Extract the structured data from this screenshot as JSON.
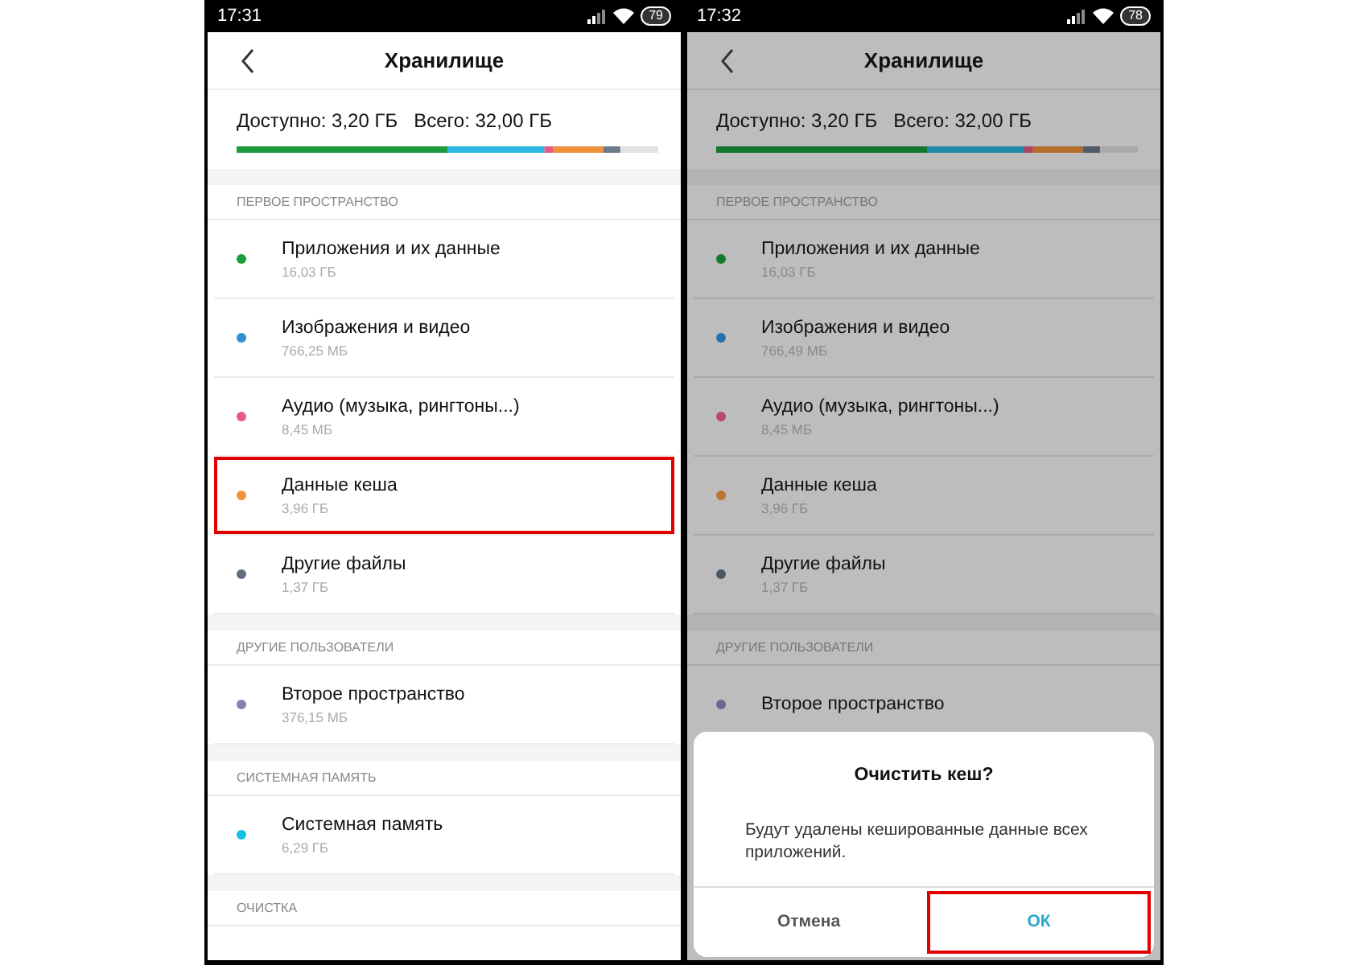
{
  "screens": [
    {
      "dimmed": false,
      "status": {
        "time": "17:31",
        "battery": "79"
      },
      "title": "Хранилище",
      "available": "Доступно: 3,20 ГБ",
      "total": "Всего: 32,00 ГБ",
      "sections": [
        {
          "header": "ПЕРВОЕ ПРОСТРАНСТВО",
          "items": [
            {
              "title": "Приложения и их данные",
              "size": "16,03 ГБ",
              "color": "#1a9c3a",
              "highlighted": false
            },
            {
              "title": "Изображения и видео",
              "size": "766,25 МБ",
              "color": "#2f8fd0",
              "highlighted": false
            },
            {
              "title": "Аудио (музыка, рингтоны...)",
              "size": "8,45 МБ",
              "color": "#e85a8a",
              "highlighted": false
            },
            {
              "title": "Данные кеша",
              "size": "3,96 ГБ",
              "color": "#f0923a",
              "highlighted": true
            },
            {
              "title": "Другие файлы",
              "size": "1,37 ГБ",
              "color": "#5d6e80",
              "highlighted": false
            }
          ]
        },
        {
          "header": "ДРУГИЕ ПОЛЬЗОВАТЕЛИ",
          "items": [
            {
              "title": "Второе пространство",
              "size": "376,15 МБ",
              "color": "#8a7fb0",
              "highlighted": false
            }
          ]
        },
        {
          "header": "СИСТЕМНАЯ ПАМЯТЬ",
          "items": [
            {
              "title": "Системная память",
              "size": "6,29 ГБ",
              "color": "#12c0e0",
              "highlighted": false
            }
          ]
        },
        {
          "header": "ОЧИСТКА"
        }
      ]
    },
    {
      "dimmed": true,
      "status": {
        "time": "17:32",
        "battery": "78"
      },
      "title": "Хранилище",
      "available": "Доступно: 3,20 ГБ",
      "total": "Всего: 32,00 ГБ",
      "sections": [
        {
          "header": "ПЕРВОЕ ПРОСТРАНСТВО",
          "items": [
            {
              "title": "Приложения и их данные",
              "size": "16,03 ГБ",
              "color": "#147a2d",
              "highlighted": false
            },
            {
              "title": "Изображения и видео",
              "size": "766,49 МБ",
              "color": "#2670a8",
              "highlighted": false
            },
            {
              "title": "Аудио (музыка, рингтоны...)",
              "size": "8,45 МБ",
              "color": "#b84a6e",
              "highlighted": false
            },
            {
              "title": "Данные кеша",
              "size": "3,96 ГБ",
              "color": "#bc7530",
              "highlighted": false
            },
            {
              "title": "Другие файлы",
              "size": "1,37 ГБ",
              "color": "#4a5766",
              "highlighted": false
            }
          ]
        },
        {
          "header": "ДРУГИЕ ПОЛЬЗОВАТЕЛИ",
          "items": [
            {
              "title": "Второе пространство",
              "color": "#6e6690",
              "highlighted": false
            }
          ]
        }
      ],
      "dialog": {
        "title": "Очистить кеш?",
        "message": "Будут удалены кешированные данные всех приложений.",
        "buttons": [
          {
            "label": "Отмена",
            "kind": "cancel",
            "highlighted": false
          },
          {
            "label": "ОК",
            "kind": "confirm",
            "highlighted": true
          }
        ]
      }
    }
  ]
}
